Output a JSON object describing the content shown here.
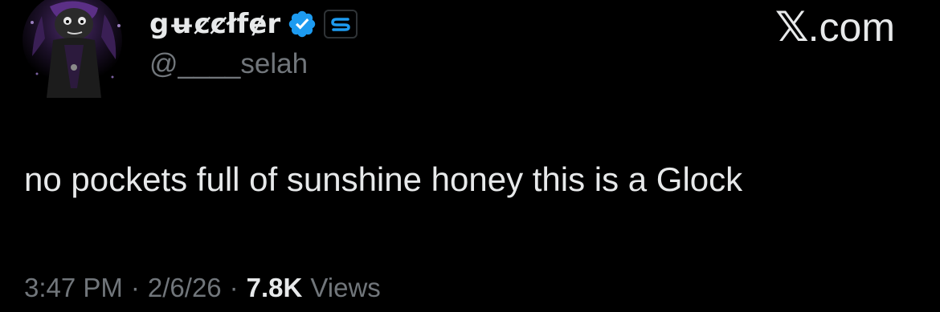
{
  "tweet": {
    "display_name": "gʉȼȼłfɇr",
    "handle": "@____selah",
    "text": "no pockets full of sunshine honey this is a Glock",
    "time": "3:47 PM",
    "date": "2/6/26",
    "separator": "·",
    "views_count": "7.8K",
    "views_label": "Views"
  },
  "watermark": {
    "label": "X.com",
    "x_part": "𝕏",
    "domain_part": ".com"
  },
  "badges": {
    "verified_icon": "verified-check-icon",
    "verified_color": "#1d9bf0",
    "subscription_icon": "subscription-s-icon"
  },
  "colors": {
    "background": "#000000",
    "primary_text": "#e7e9ea",
    "secondary_text": "#71767b"
  }
}
